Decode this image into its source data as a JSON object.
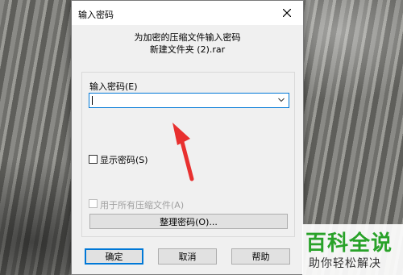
{
  "dialog": {
    "title": "输入密码",
    "header_line1": "为加密的压缩文件输入密码",
    "header_line2": "新建文件夹 (2).rar",
    "password_label": "输入密码(E)",
    "password_value": "",
    "show_password_label": "显示密码(S)",
    "show_password_checked": false,
    "use_all_label": "用于所有压缩文件(A)",
    "use_all_checked": false,
    "organize_button": "整理密码(O)...",
    "ok_button": "确定",
    "cancel_button": "取消",
    "help_button": "帮助"
  },
  "watermark": {
    "title": "百科全说",
    "subtitle": "助你轻松解决"
  },
  "colors": {
    "accent": "#0078d7",
    "dialog_bg": "#f0f0f0",
    "annotation_arrow": "#e8302f",
    "watermark_green": "#29a229"
  },
  "icons": {
    "close": "close-icon",
    "dropdown": "chevron-down-icon",
    "annotation": "red-arrow-icon"
  }
}
